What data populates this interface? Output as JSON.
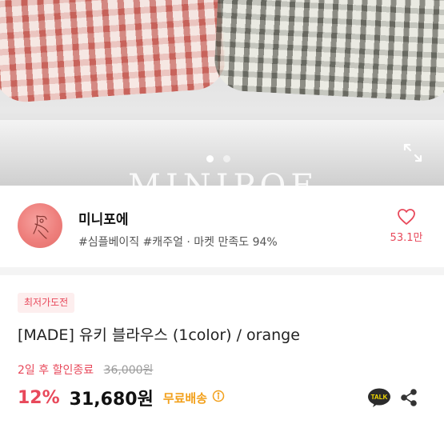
{
  "hero": {
    "watermark": "MINIPOE",
    "carousel": {
      "total": 2,
      "current": 1
    },
    "expand_icon": "expand-icon"
  },
  "seller": {
    "name": "미니포에",
    "tags": "#심플베이직 #캐주얼 · 마켓 만족도 94%",
    "like_icon": "heart-outline-icon",
    "like_count": "53.1만"
  },
  "product": {
    "badge": "최저가도전",
    "title": "[MADE] 유키 블라우스 (1color) / orange",
    "sale_end": "2일 후 할인종료",
    "original_price": "36,000원",
    "discount": "12%",
    "price": "31,680원",
    "shipping": "무료배송",
    "info_icon": "info-circle-icon",
    "talk_icon": "kakao-talk-icon",
    "share_icon": "share-icon"
  },
  "colors": {
    "accent_red": "#e8495b",
    "shipping_orange": "#f2a01b"
  }
}
